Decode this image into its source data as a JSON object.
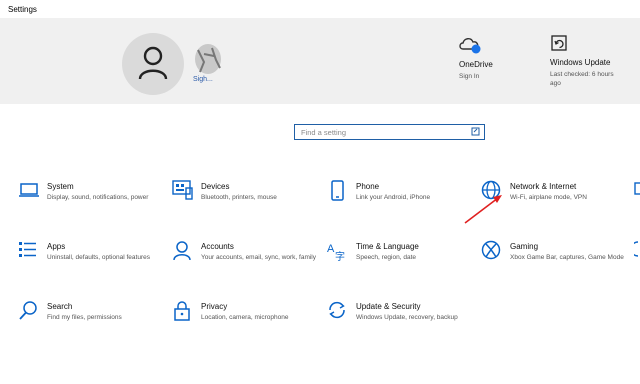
{
  "window": {
    "title": "Settings"
  },
  "account": {
    "name": "Sigh..."
  },
  "quick_links": [
    {
      "title": "OneDrive",
      "sub": "Sign In"
    },
    {
      "title": "Windows Update",
      "sub": "Last checked: 6 hours ago"
    }
  ],
  "search": {
    "placeholder": "Find a setting"
  },
  "tiles": [
    {
      "icon": "laptop-icon",
      "name": "System",
      "desc": "Display, sound, notifications, power"
    },
    {
      "icon": "keyboard-icon",
      "name": "Devices",
      "desc": "Bluetooth, printers, mouse"
    },
    {
      "icon": "phone-icon",
      "name": "Phone",
      "desc": "Link your Android, iPhone"
    },
    {
      "icon": "globe-icon",
      "name": "Network & Internet",
      "desc": "Wi-Fi, airplane mode, VPN"
    },
    {
      "icon": "apps-list-icon",
      "name": "Apps",
      "desc": "Uninstall, defaults, optional features"
    },
    {
      "icon": "person-icon",
      "name": "Accounts",
      "desc": "Your accounts, email, sync, work, family"
    },
    {
      "icon": "time-language-icon",
      "name": "Time & Language",
      "desc": "Speech, region, date"
    },
    {
      "icon": "xbox-icon",
      "name": "Gaming",
      "desc": "Xbox Game Bar, captures, Game Mode"
    },
    {
      "icon": "search-icon",
      "name": "Search",
      "desc": "Find my files, permissions"
    },
    {
      "icon": "lock-icon",
      "name": "Privacy",
      "desc": "Location, camera, microphone"
    },
    {
      "icon": "refresh-icon",
      "name": "Update & Security",
      "desc": "Windows Update, recovery, backup"
    }
  ],
  "colors": {
    "accent": "#0a64c8",
    "banner": "#f0f0f0",
    "annotation_arrow": "#e02020"
  }
}
